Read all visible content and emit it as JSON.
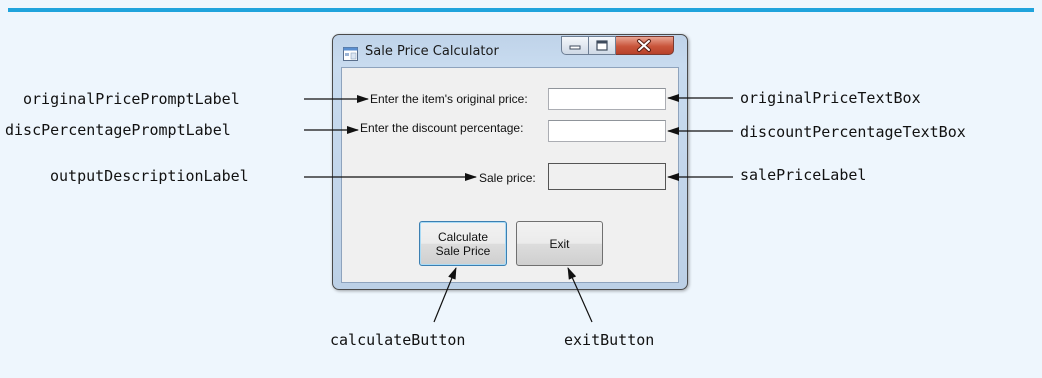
{
  "window": {
    "title": "Sale Price Calculator",
    "controls": [
      "minimize-icon",
      "maximize-icon",
      "close-icon"
    ]
  },
  "form": {
    "original_price_prompt": "Enter the item's original price:",
    "discount_percentage_prompt": "Enter the discount percentage:",
    "output_description": "Sale price:",
    "original_price_value": "",
    "discount_percentage_value": "",
    "sale_price_value": "",
    "calculate_button_label": "Calculate\nSale Price",
    "exit_button_label": "Exit"
  },
  "callouts": {
    "left": [
      "originalPricePromptLabel",
      "discPercentagePromptLabel",
      "outputDescriptionLabel"
    ],
    "right": [
      "originalPriceTextBox",
      "discountPercentageTextBox",
      "salePriceLabel"
    ],
    "bottom": [
      "calculateButton",
      "exitButton"
    ]
  },
  "colors": {
    "accent_rule": "#1fa3dc",
    "figure_background": "#eef6fd"
  }
}
